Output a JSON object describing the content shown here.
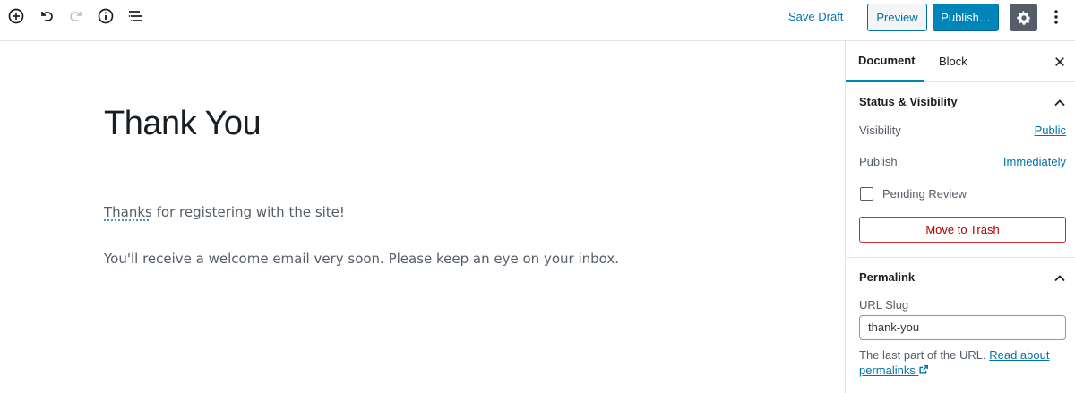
{
  "toolbar": {
    "save_draft": "Save Draft",
    "preview": "Preview",
    "publish": "Publish…"
  },
  "post": {
    "title": "Thank You",
    "para1_word": "Thanks",
    "para1_rest": " for registering with the site!",
    "para2": "You'll receive a welcome email very soon. Please keep an eye on your inbox."
  },
  "sidebar": {
    "tabs": [
      "Document",
      "Block"
    ],
    "status_panel": {
      "title": "Status & Visibility",
      "visibility_label": "Visibility",
      "visibility_value": "Public",
      "publish_label": "Publish",
      "publish_value": "Immediately",
      "pending_review": "Pending Review",
      "move_to_trash": "Move to Trash"
    },
    "permalink_panel": {
      "title": "Permalink",
      "slug_label": "URL Slug",
      "slug_value": "thank-you",
      "help_text": "The last part of the URL. ",
      "help_link": "Read about permalinks"
    }
  },
  "colors": {
    "accent": "#0085ba",
    "link": "#0073aa",
    "danger": "#a00"
  },
  "icons": [
    "add-block-icon",
    "undo-icon",
    "redo-icon",
    "info-icon",
    "outline-icon",
    "gear-icon",
    "more-vertical-icon",
    "close-icon",
    "chevron-up-icon",
    "external-link-icon"
  ]
}
